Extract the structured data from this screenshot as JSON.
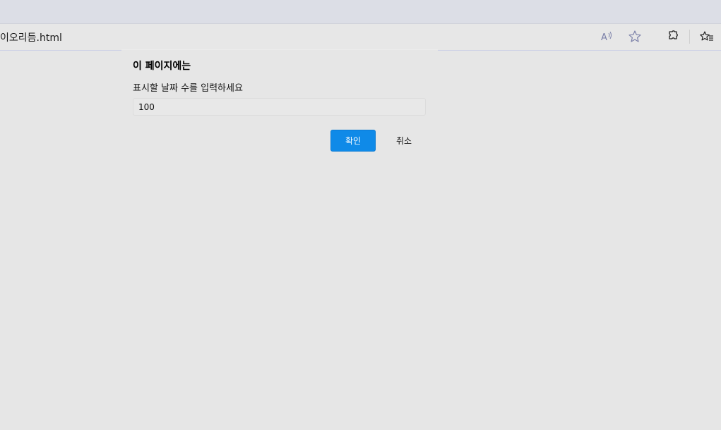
{
  "browser": {
    "url_text": "이오리듬.html",
    "icons": [
      "read-aloud-icon",
      "favorite-star-icon",
      "extensions-icon",
      "favorites-list-icon"
    ]
  },
  "dialog": {
    "title": "이 페이지에는",
    "message": "표시할 날짜 수를 입력하세요",
    "input_value": "100",
    "ok_label": "확인",
    "cancel_label": "취소",
    "ok_color": "#0f8ae8"
  }
}
